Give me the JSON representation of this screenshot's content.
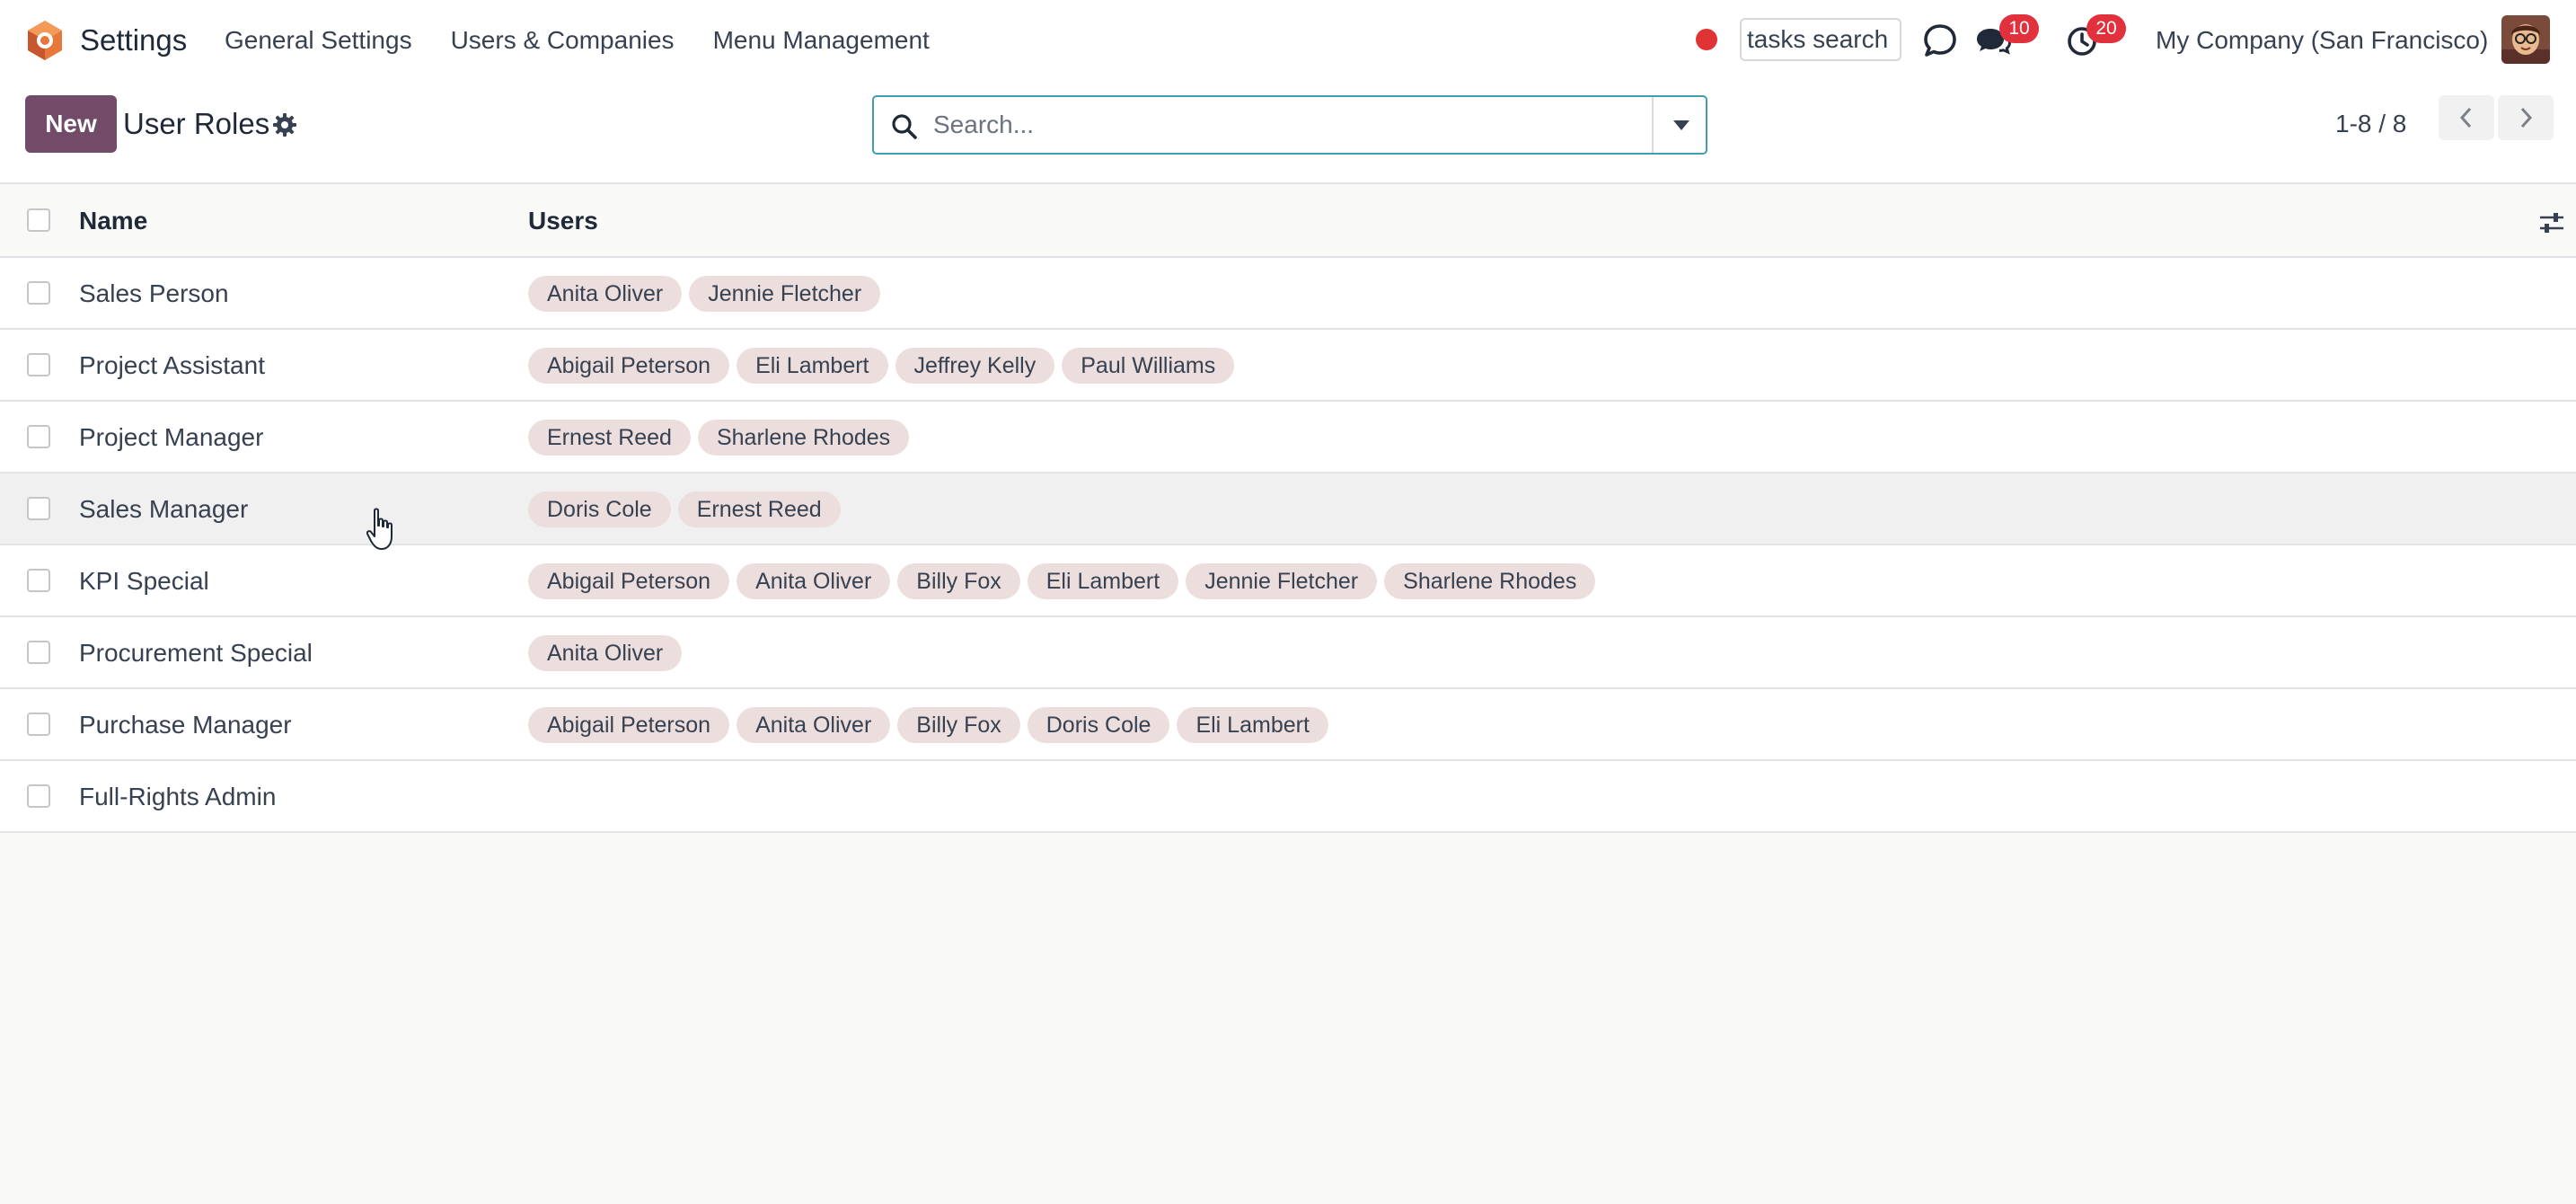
{
  "navbar": {
    "app_name": "Settings",
    "menu": [
      "General Settings",
      "Users & Companies",
      "Menu Management"
    ],
    "tasks_search_placeholder": "tasks search",
    "messages_count": "10",
    "activities_count": "20",
    "company": "My Company (San Francisco)"
  },
  "control_panel": {
    "new_label": "New",
    "title": "User Roles",
    "search_placeholder": "Search...",
    "pager_value": "1-8 / 8"
  },
  "list": {
    "columns": [
      "Name",
      "Users"
    ],
    "rows": [
      {
        "name": "Sales Person",
        "users": [
          "Anita Oliver",
          "Jennie Fletcher"
        ]
      },
      {
        "name": "Project Assistant",
        "users": [
          "Abigail Peterson",
          "Eli Lambert",
          "Jeffrey Kelly",
          "Paul Williams"
        ]
      },
      {
        "name": "Project Manager",
        "users": [
          "Ernest Reed",
          "Sharlene Rhodes"
        ]
      },
      {
        "name": "Sales Manager",
        "users": [
          "Doris Cole",
          "Ernest Reed"
        ]
      },
      {
        "name": "KPI Special",
        "users": [
          "Abigail Peterson",
          "Anita Oliver",
          "Billy Fox",
          "Eli Lambert",
          "Jennie Fletcher",
          "Sharlene Rhodes"
        ]
      },
      {
        "name": "Procurement Special",
        "users": [
          "Anita Oliver"
        ]
      },
      {
        "name": "Purchase Manager",
        "users": [
          "Abigail Peterson",
          "Anita Oliver",
          "Billy Fox",
          "Doris Cole",
          "Eli Lambert"
        ]
      },
      {
        "name": "Full-Rights Admin",
        "users": []
      }
    ]
  },
  "colors": {
    "primary": "#714b67",
    "search_border": "#3f9fb2",
    "tag_bg": "#ebdedc",
    "badge": "#e0313d",
    "record_dot": "#e03434"
  },
  "icons": [
    "app-logo-icon",
    "gear-icon",
    "search-icon",
    "caret-down-icon",
    "chevron-left-icon",
    "chevron-right-icon",
    "discuss-icon",
    "chat-icon",
    "clock-icon",
    "sliders-icon",
    "pointer-cursor-icon"
  ]
}
